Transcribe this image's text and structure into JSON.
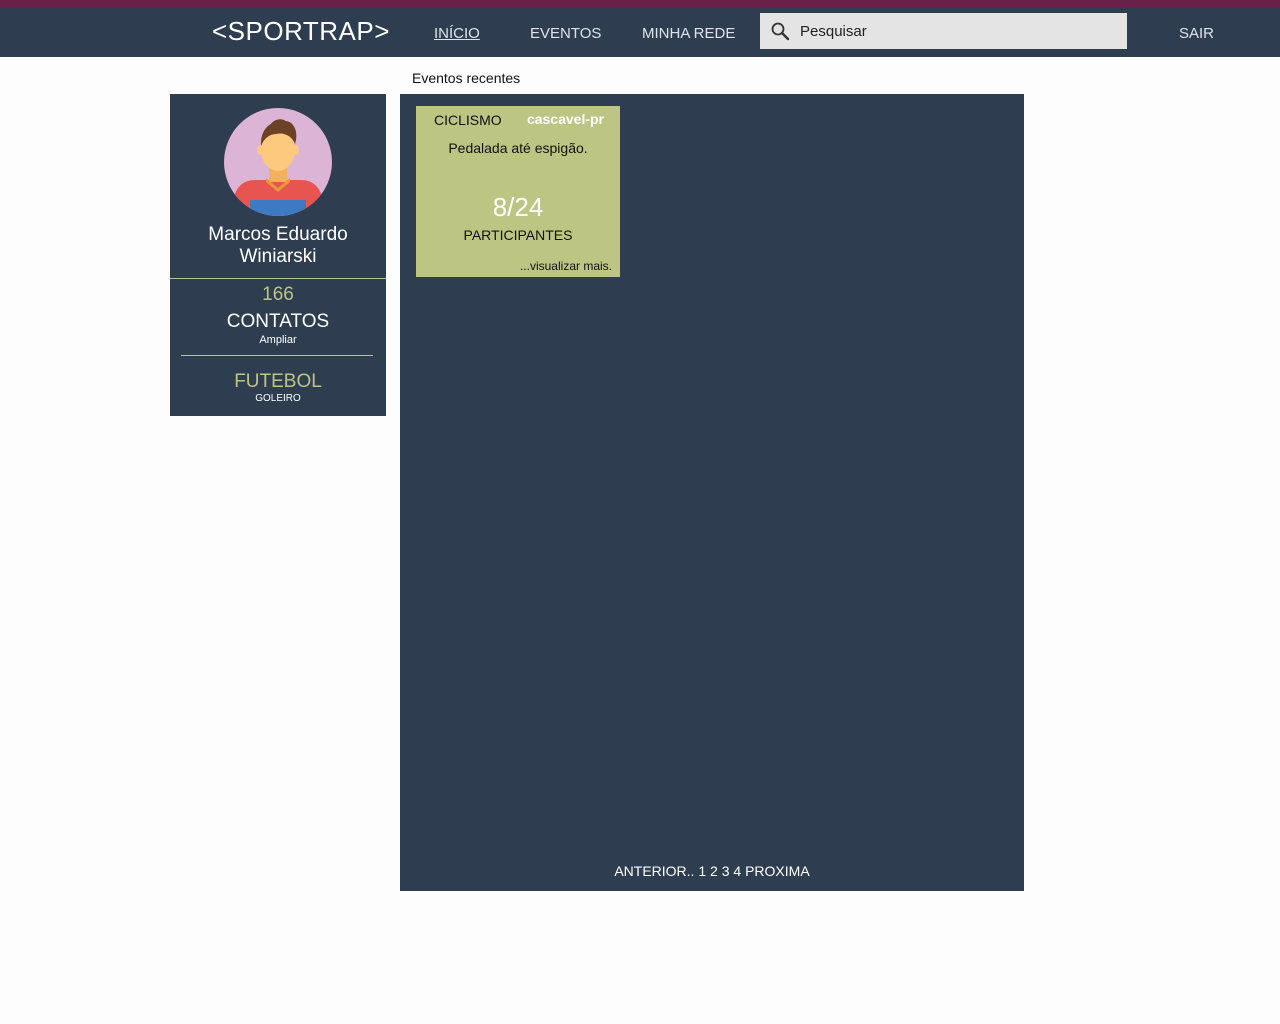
{
  "header": {
    "brand": "<SPORTRAP>",
    "nav": {
      "inicio": "INÍCIO",
      "eventos": "EVENTOS",
      "minha_rede": "MINHA REDE",
      "sair": "SAIR"
    },
    "search": {
      "placeholder": "Pesquisar",
      "icon": "search-icon"
    },
    "colors": {
      "bar": "#2e3e50",
      "stripe": "#6a2048"
    }
  },
  "main": {
    "section_title": "Eventos recentes"
  },
  "profile": {
    "name": "Marcos Eduardo Winiarski",
    "contacts_count": "166",
    "contacts_label": "CONTATOS",
    "contacts_expand": "Ampliar",
    "sport": "FUTEBOL",
    "position": "GOLEIRO",
    "avatar_icon": "user-avatar-icon",
    "accent_color": "#bdc583"
  },
  "events": {
    "cards": [
      {
        "sport": "CICLISMO",
        "city": "cascavel-pr",
        "description": "Pedalada até espigão.",
        "participants": "8/24",
        "participants_label": "PARTICIPANTES",
        "more": "...visualizar mais."
      }
    ],
    "pagination": {
      "previous": "ANTERIOR..",
      "pages": [
        "1",
        "2",
        "3",
        "4"
      ],
      "next": "PROXIMA"
    }
  }
}
